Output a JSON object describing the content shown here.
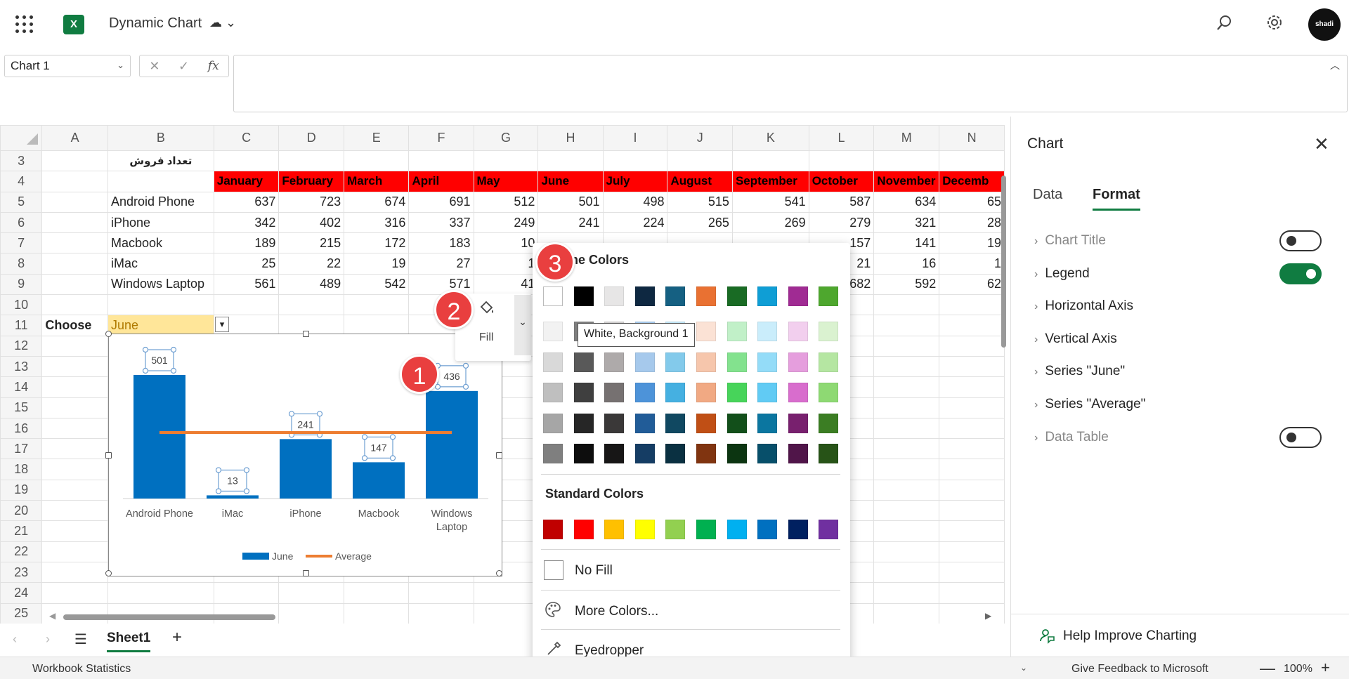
{
  "app": {
    "title": "Dynamic Chart",
    "title_icons": "☁ ⌄",
    "logo_letter": "X",
    "avatar_text": "shadi"
  },
  "formula_bar": {
    "name_box": "Chart 1",
    "cancel_glyph": "✕",
    "enter_glyph": "✓",
    "fx_glyph": "fx",
    "formula": ""
  },
  "grid": {
    "columns": [
      "A",
      "B",
      "C",
      "D",
      "E",
      "F",
      "G",
      "H",
      "I",
      "J",
      "K",
      "L",
      "M",
      "N"
    ],
    "row3_title": "تعداد فروش",
    "months": [
      "January",
      "February",
      "March",
      "April",
      "May",
      "June",
      "July",
      "August",
      "September",
      "October",
      "November",
      "Decemb"
    ],
    "rows": [
      {
        "row": "5",
        "label": "Android Phone",
        "values": [
          "637",
          "723",
          "674",
          "691",
          "512",
          "501",
          "498",
          "515",
          "541",
          "587",
          "634",
          "65"
        ]
      },
      {
        "row": "6",
        "label": "iPhone",
        "values": [
          "342",
          "402",
          "316",
          "337",
          "249",
          "241",
          "224",
          "265",
          "269",
          "279",
          "321",
          "28"
        ]
      },
      {
        "row": "7",
        "label": "Macbook",
        "values": [
          "189",
          "215",
          "172",
          "183",
          "10",
          "",
          "",
          "",
          "",
          "157",
          "141",
          "19"
        ]
      },
      {
        "row": "8",
        "label": "iMac",
        "values": [
          "25",
          "22",
          "19",
          "27",
          "1",
          "",
          "",
          "",
          "",
          "21",
          "16",
          "1"
        ]
      },
      {
        "row": "9",
        "label": "Windows Laptop",
        "values": [
          "561",
          "489",
          "542",
          "571",
          "41",
          "",
          "",
          "",
          "",
          "682",
          "592",
          "62"
        ]
      }
    ],
    "row_numbers": [
      "3",
      "4",
      "5",
      "6",
      "7",
      "8",
      "9",
      "10",
      "11",
      "12",
      "13",
      "14",
      "15",
      "16",
      "17",
      "18",
      "19",
      "20",
      "21",
      "22",
      "23",
      "24",
      "25"
    ],
    "choose_label": "Choose",
    "choose_value": "June"
  },
  "chart_data": {
    "type": "bar",
    "categories": [
      "Android Phone",
      "iMac",
      "iPhone",
      "Macbook",
      "Windows Laptop"
    ],
    "category_lines": [
      [
        "Android Phone"
      ],
      [
        "iMac"
      ],
      [
        "iPhone"
      ],
      [
        "Macbook"
      ],
      [
        "Windows",
        "Laptop"
      ]
    ],
    "series": [
      {
        "name": "June",
        "type": "bar",
        "values": [
          501,
          13,
          241,
          147,
          436
        ],
        "color": "#0070c0"
      },
      {
        "name": "Average",
        "type": "line",
        "color": "#ed7d31"
      }
    ],
    "ylim": [
      0,
      501
    ],
    "legend": "bottom"
  },
  "fill_button": {
    "label": "Fill",
    "icon": "paint-bucket-icon"
  },
  "palette": {
    "theme_title": "Theme Colors",
    "theme_top_row": [
      "#ffffff",
      "#000000",
      "#e7e6e6",
      "#0e2841",
      "#156082",
      "#e97132",
      "#196b24",
      "#0f9ed5",
      "#a02b93",
      "#4ea72e"
    ],
    "theme_shades": [
      [
        "#f2f2f2",
        "#7f7f7f",
        "#d0cece",
        "#a5c8ec",
        "#c0e4f5",
        "#fbe2d5",
        "#c1f0c8",
        "#caedfb",
        "#f2cfee",
        "#daf2d0"
      ],
      [
        "#d9d9d9",
        "#595959",
        "#aeaaaa",
        "#a6c9ec",
        "#83caeb",
        "#f6c6ac",
        "#83e28e",
        "#94dcf8",
        "#e59edd",
        "#b5e6a2"
      ],
      [
        "#bfbfbf",
        "#3f3f3f",
        "#767171",
        "#4d93d9",
        "#45b0e1",
        "#f1a983",
        "#47d45a",
        "#61cbf4",
        "#d86dcd",
        "#8ed973"
      ],
      [
        "#a6a6a6",
        "#262626",
        "#3a3838",
        "#215c98",
        "#104861",
        "#c04f15",
        "#124f1a",
        "#0b76a0",
        "#78206e",
        "#3b7d23"
      ],
      [
        "#7f7f7f",
        "#0d0d0d",
        "#171616",
        "#153d64",
        "#0a3041",
        "#803410",
        "#0c3511",
        "#074f6a",
        "#501549",
        "#275317"
      ]
    ],
    "standard_title": "Standard Colors",
    "standard": [
      "#c00000",
      "#ff0000",
      "#ffc000",
      "#ffff00",
      "#92d050",
      "#00b050",
      "#00b0f0",
      "#0070c0",
      "#002060",
      "#7030a0"
    ],
    "no_fill": "No Fill",
    "more_colors": "More Colors...",
    "eyedropper": "Eyedropper",
    "tooltip": "White, Background 1"
  },
  "markers": [
    "1",
    "2",
    "3"
  ],
  "pane": {
    "title": "Chart",
    "tabs": [
      "Data",
      "Format"
    ],
    "items": [
      {
        "label": "Chart Title",
        "toggle": "off",
        "disabled": true
      },
      {
        "label": "Legend",
        "toggle": "on",
        "disabled": false
      },
      {
        "label": "Horizontal Axis",
        "disabled": false
      },
      {
        "label": "Vertical Axis",
        "disabled": false
      },
      {
        "label": "Series \"June\"",
        "disabled": false
      },
      {
        "label": "Series \"Average\"",
        "disabled": false
      },
      {
        "label": "Data Table",
        "toggle": "off",
        "disabled": true
      }
    ],
    "help": "Help Improve Charting"
  },
  "sheets": {
    "active": "Sheet1",
    "add": "+"
  },
  "status": {
    "stats": "Workbook Statistics",
    "feedback": "Give Feedback to Microsoft",
    "zoom": "100%",
    "zoom_minus": "—",
    "zoom_plus": "+"
  }
}
